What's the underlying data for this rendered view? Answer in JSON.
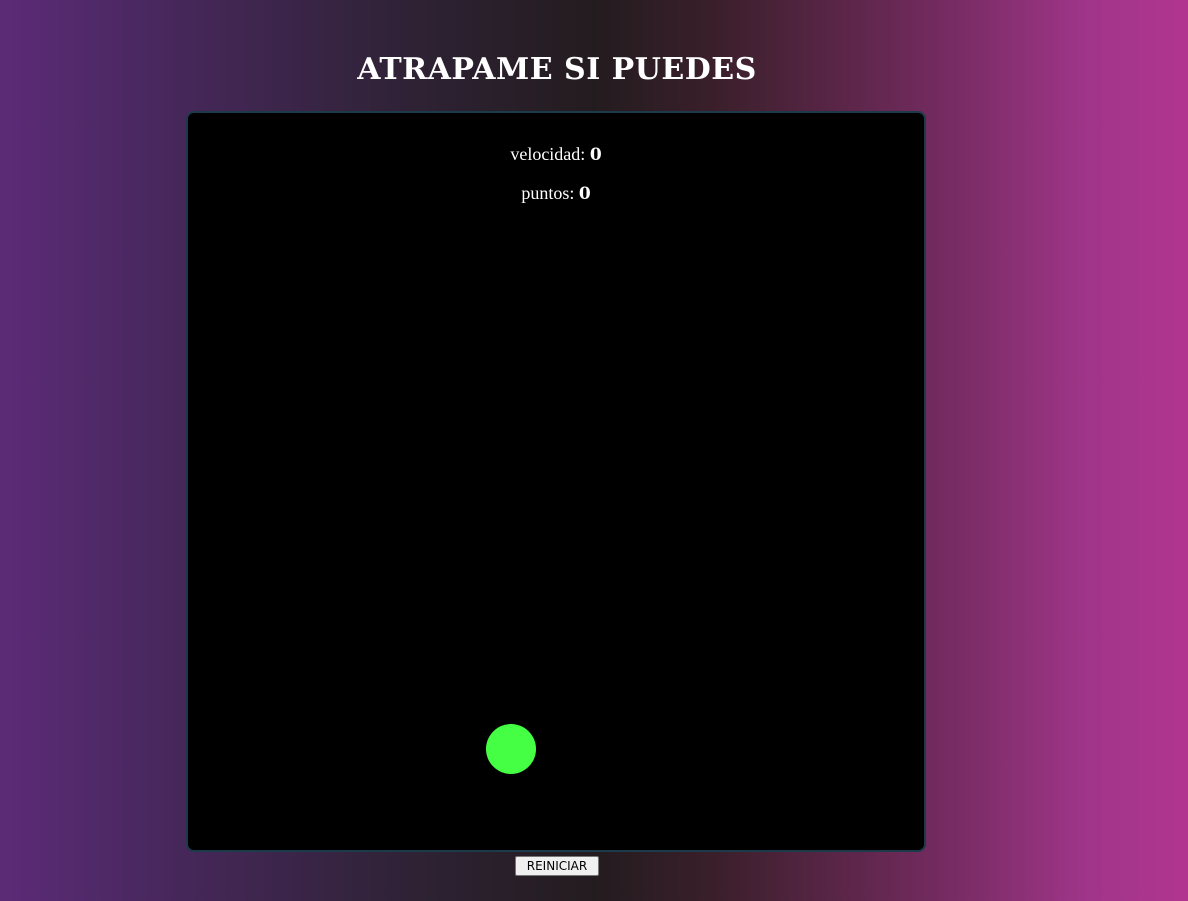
{
  "header": {
    "title": "ATRAPAME SI PUEDES"
  },
  "stats": {
    "speed_label": "velocidad:",
    "speed_value": "0",
    "points_label": "puntos:",
    "points_value": "0"
  },
  "target": {
    "color": "#44ff44"
  },
  "controls": {
    "restart_label": "REINICIAR"
  },
  "colors": {
    "board_background": "#000000",
    "board_border": "#1c3a4a",
    "text": "#ffffff"
  }
}
